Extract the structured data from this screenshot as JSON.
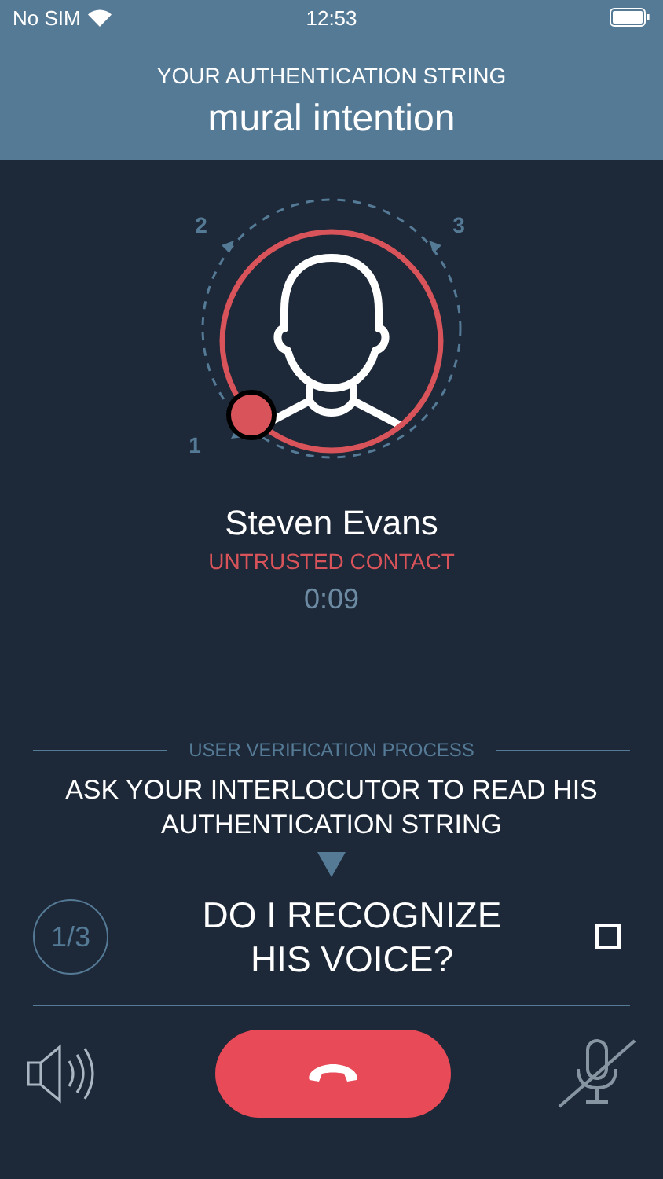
{
  "status_bar": {
    "carrier": "No SIM",
    "time": "12:53"
  },
  "header": {
    "label": "YOUR AUTHENTICATION STRING",
    "string": "mural intention"
  },
  "steps": [
    {
      "label": "1"
    },
    {
      "label": "2"
    },
    {
      "label": "3"
    }
  ],
  "contact": {
    "name": "Steven Evans",
    "status": "UNTRUSTED CONTACT",
    "duration": "0:09"
  },
  "verification": {
    "title": "USER VERIFICATION PROCESS",
    "instruction": "ASK YOUR INTERLOCUTOR TO READ HIS AUTHENTICATION STRING",
    "step": "1/3",
    "question": "DO I RECOGNIZE HIS VOICE?",
    "checked": false
  },
  "controls": {
    "mic_muted": true
  }
}
